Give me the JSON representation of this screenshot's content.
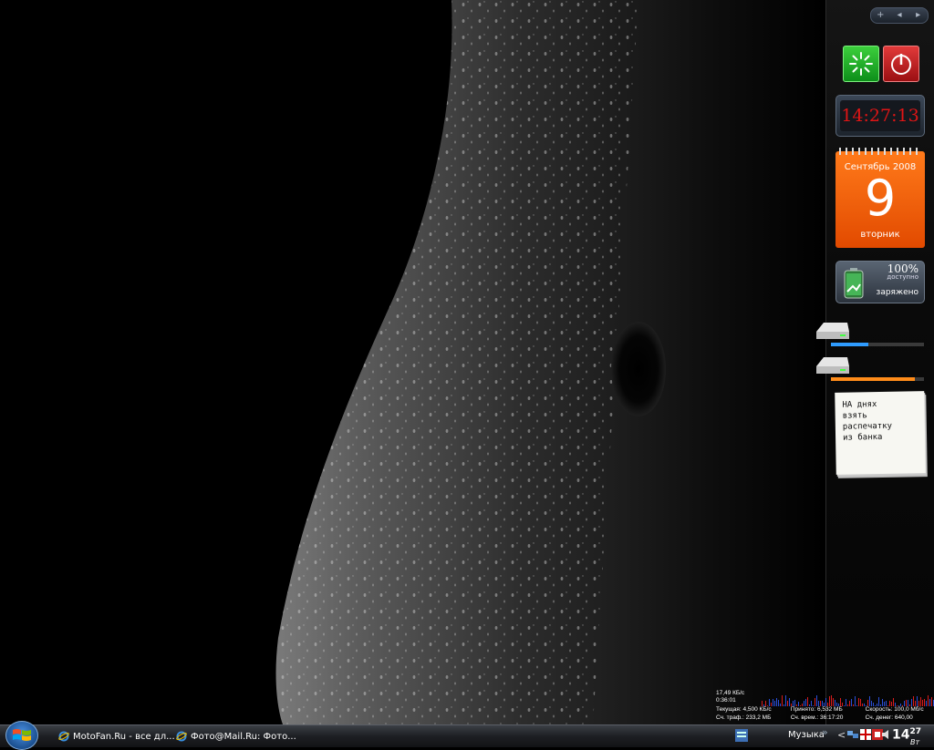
{
  "colors": {
    "calendar": "#ff6a0f",
    "clock_digits": "#e01515",
    "drive1_fill": "#2f9cff",
    "drive2_fill": "#ff8c1a"
  },
  "sidebar": {
    "controls": {
      "add": "+",
      "prev": "◂",
      "next": "▸"
    },
    "clock": {
      "time": "14:27:13"
    },
    "calendar": {
      "month_year": "Сентябрь 2008",
      "day": "9",
      "weekday": "вторник"
    },
    "battery": {
      "percent": "100%",
      "available": "доступно",
      "status": "заряжено"
    },
    "drives": [
      {
        "name": "drive-1",
        "used": 0.4
      },
      {
        "name": "drive-2",
        "used": 0.9
      }
    ],
    "note": {
      "lines": [
        "НА днях",
        "взять",
        "распечатку",
        "из банка"
      ]
    }
  },
  "network": {
    "speed_now": "17,49 КБ/с",
    "session_time": "0:36:01",
    "current": "Текущая: 4,500 КБ/с",
    "received": "Принято: 6,532 МБ",
    "speed": "Скорость: 100,0 Мб/с",
    "traffic": "Сч. траф.: 233,2 МБ",
    "time": "Сч. врем.: 36:17:20",
    "money": "Сч. денег: 640,00"
  },
  "taskbar": {
    "items": [
      {
        "label": "MotoFan.Ru - все дл..."
      },
      {
        "label": "Фото@Mail.Ru: Фото..."
      }
    ],
    "toolbar_label": "Музыка",
    "chevron": "»",
    "tray_arrow": "<",
    "clock": {
      "hours": "14",
      "minutes": "27",
      "weekday": "Вт"
    }
  }
}
